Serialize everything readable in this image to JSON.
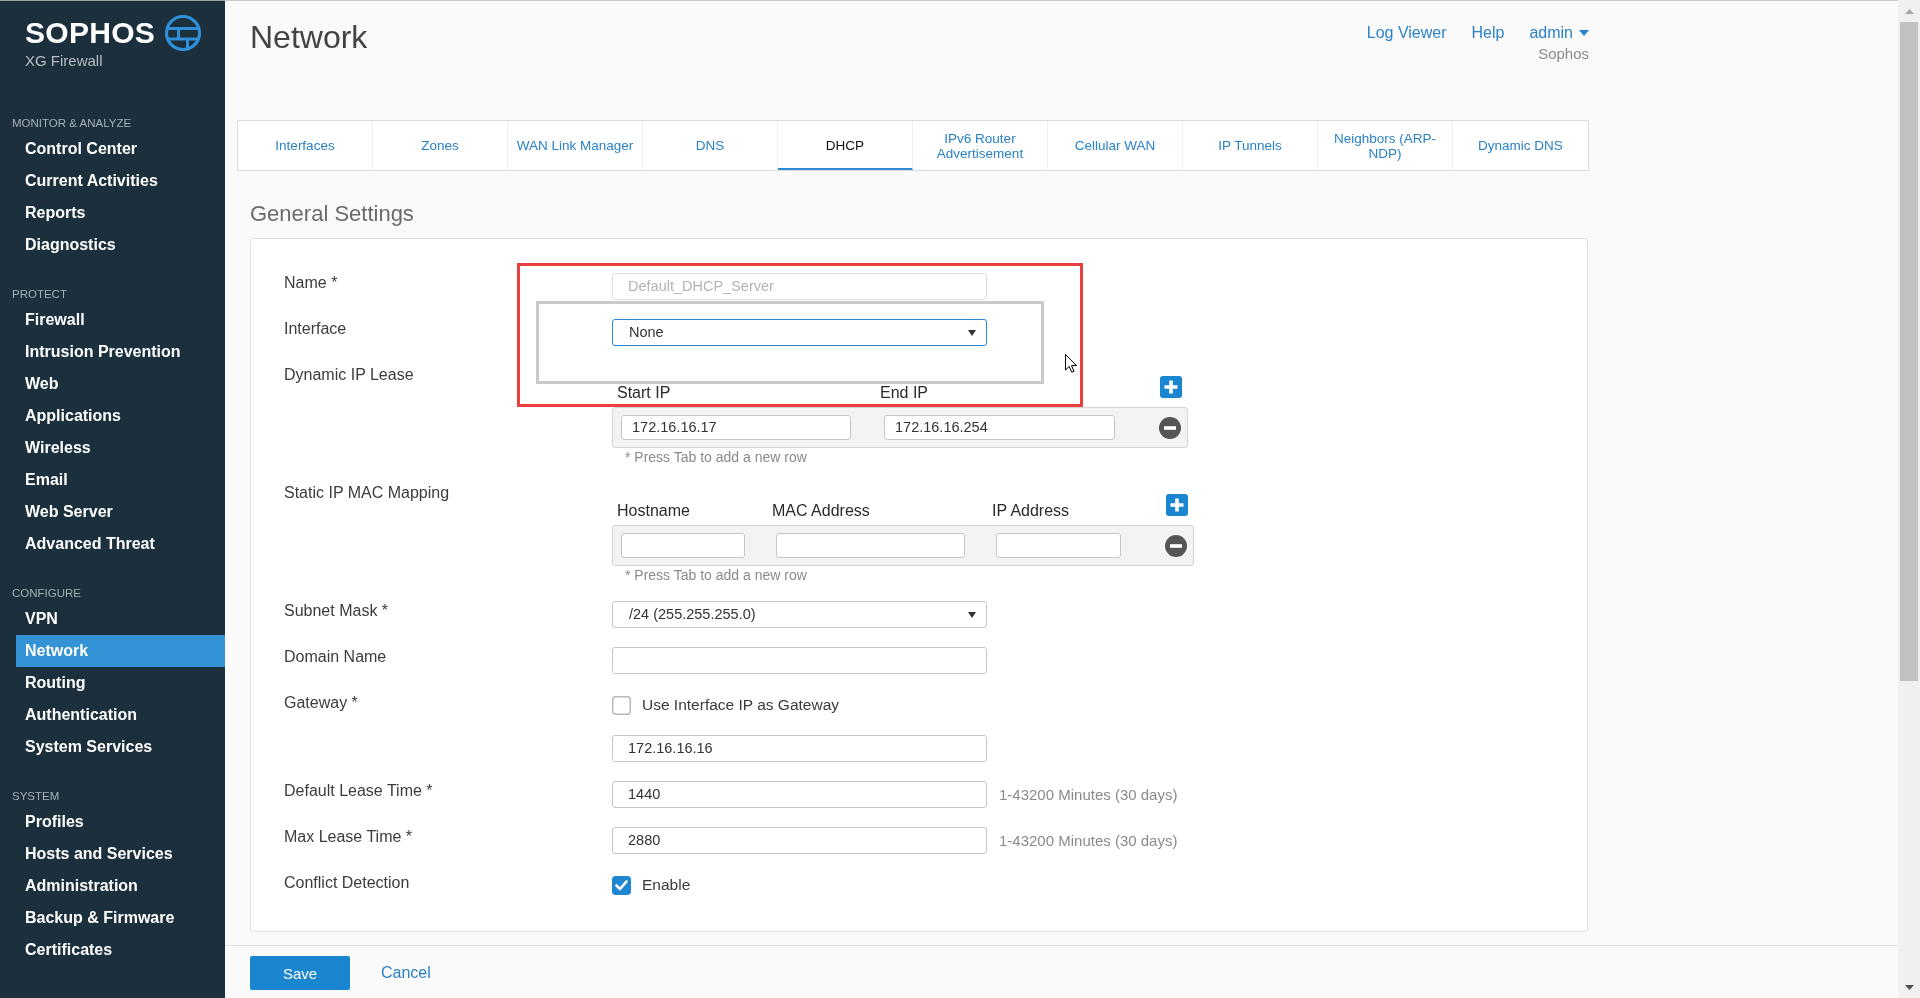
{
  "sidebar": {
    "brand": "SOPHOS",
    "product": "XG Firewall",
    "sections": [
      {
        "heading": "MONITOR & ANALYZE",
        "items": [
          {
            "label": "Control Center",
            "selected": false
          },
          {
            "label": "Current Activities",
            "selected": false
          },
          {
            "label": "Reports",
            "selected": false
          },
          {
            "label": "Diagnostics",
            "selected": false
          }
        ]
      },
      {
        "heading": "PROTECT",
        "items": [
          {
            "label": "Firewall",
            "selected": false
          },
          {
            "label": "Intrusion Prevention",
            "selected": false
          },
          {
            "label": "Web",
            "selected": false
          },
          {
            "label": "Applications",
            "selected": false
          },
          {
            "label": "Wireless",
            "selected": false
          },
          {
            "label": "Email",
            "selected": false
          },
          {
            "label": "Web Server",
            "selected": false
          },
          {
            "label": "Advanced Threat",
            "selected": false
          }
        ]
      },
      {
        "heading": "CONFIGURE",
        "items": [
          {
            "label": "VPN",
            "selected": false
          },
          {
            "label": "Network",
            "selected": true
          },
          {
            "label": "Routing",
            "selected": false
          },
          {
            "label": "Authentication",
            "selected": false
          },
          {
            "label": "System Services",
            "selected": false
          }
        ]
      },
      {
        "heading": "SYSTEM",
        "items": [
          {
            "label": "Profiles",
            "selected": false
          },
          {
            "label": "Hosts and Services",
            "selected": false
          },
          {
            "label": "Administration",
            "selected": false
          },
          {
            "label": "Backup & Firmware",
            "selected": false
          },
          {
            "label": "Certificates",
            "selected": false
          }
        ]
      }
    ]
  },
  "header": {
    "title": "Network",
    "links": [
      "Log Viewer",
      "Help"
    ],
    "user": {
      "name": "admin",
      "org": "Sophos"
    }
  },
  "tabs": [
    {
      "label": "Interfaces",
      "selected": false
    },
    {
      "label": "Zones",
      "selected": false
    },
    {
      "label": "WAN Link Manager",
      "selected": false
    },
    {
      "label": "DNS",
      "selected": false
    },
    {
      "label": "DHCP",
      "selected": true
    },
    {
      "label": "IPv6 Router Advertisement",
      "selected": false
    },
    {
      "label": "Cellular WAN",
      "selected": false
    },
    {
      "label": "IP Tunnels",
      "selected": false
    },
    {
      "label": "Neighbors (ARP-NDP)",
      "selected": false
    },
    {
      "label": "Dynamic DNS",
      "selected": false
    }
  ],
  "general_settings": {
    "title": "General Settings",
    "fields": [
      {
        "kind": "text",
        "label": "Name *",
        "value": "Default_DHCP_Server",
        "disabled": true,
        "focused": false
      },
      {
        "kind": "select",
        "label": "Interface",
        "value": "None",
        "disabled": false,
        "focused": true
      },
      {
        "kind": "table",
        "label": "Dynamic IP Lease",
        "columns": [
          {
            "header": "Start IP",
            "value": "172.16.16.17"
          },
          {
            "header": "End IP",
            "value": "172.16.16.254"
          }
        ],
        "hint": "* Press Tab to add a new row"
      },
      {
        "kind": "table",
        "label": "Static IP MAC Mapping",
        "columns": [
          {
            "header": "Hostname"
          },
          {
            "header": "MAC Address"
          },
          {
            "header": "IP Address"
          }
        ],
        "hint": "* Press Tab to add a new row"
      },
      {
        "kind": "select",
        "label": "Subnet Mask *",
        "value": "/24 (255.255.255.0)",
        "disabled": false,
        "focused": false
      },
      {
        "kind": "text",
        "label": "Domain Name",
        "disabled": false,
        "focused": false
      },
      {
        "kind": "gateway",
        "label": "Gateway *",
        "option": {
          "label": "Use Interface IP as Gateway",
          "checked": false
        },
        "value": "172.16.16.16",
        "disabled": false,
        "focused": false
      },
      {
        "kind": "text",
        "label": "Default Lease Time *",
        "value": "1440",
        "hint": "1-43200 Minutes (30 days)",
        "disabled": false,
        "focused": false
      },
      {
        "kind": "text",
        "label": "Max Lease Time *",
        "value": "2880",
        "hint": "1-43200 Minutes (30 days)",
        "disabled": false,
        "focused": false
      },
      {
        "kind": "checkbox",
        "label": "Conflict Detection",
        "option": {
          "label": "Enable",
          "checked": true
        }
      }
    ]
  },
  "actions": [
    {
      "label": "Save",
      "kind": "primary"
    },
    {
      "label": "Cancel",
      "kind": "link"
    }
  ]
}
